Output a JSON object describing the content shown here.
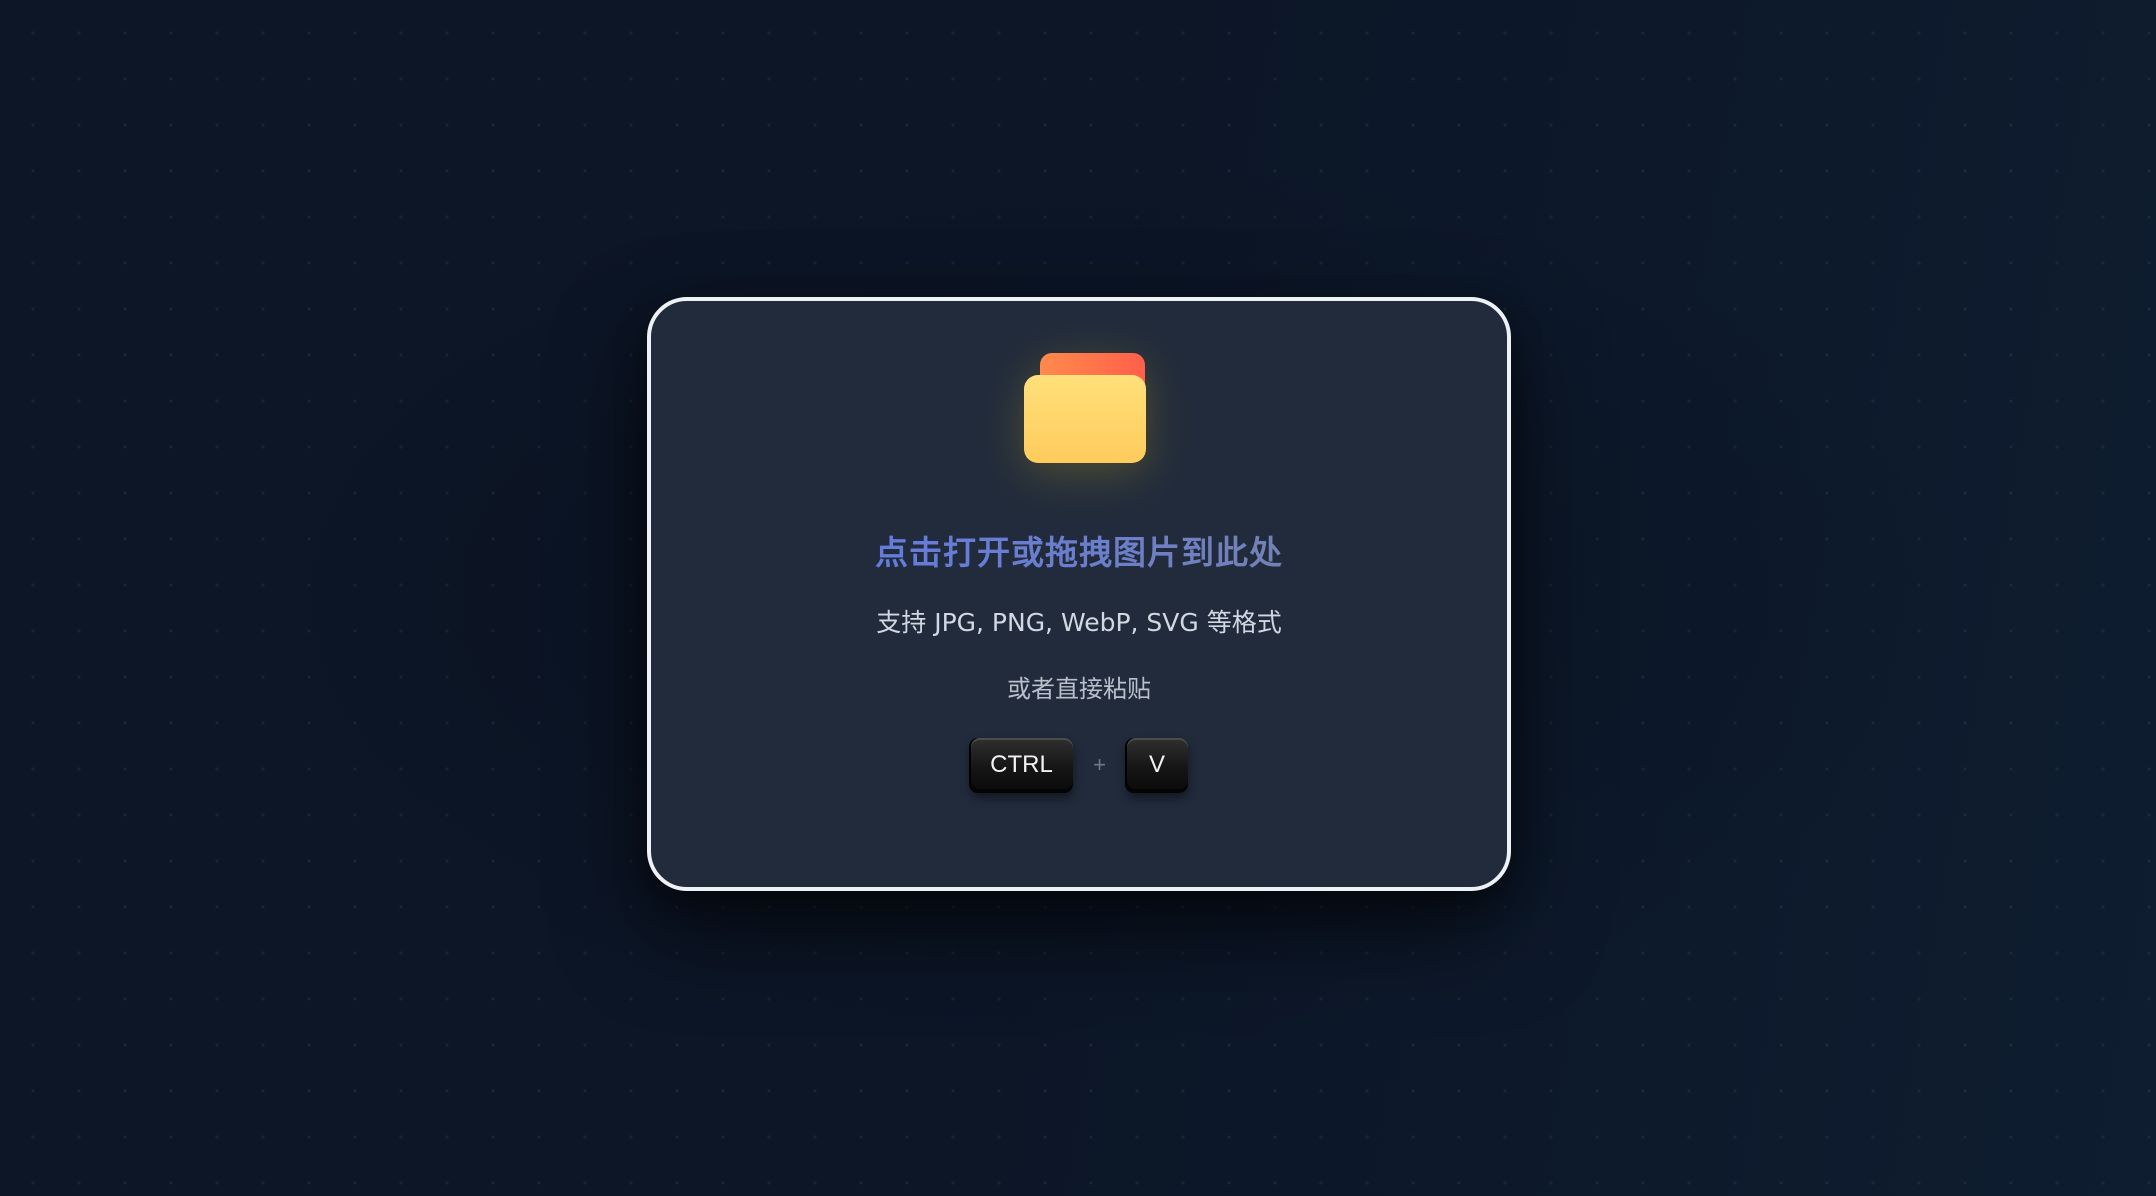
{
  "dropzone": {
    "icon": "folder-icon",
    "title": "点击打开或拖拽图片到此处",
    "formats_hint": "支持 JPG, PNG, WebP, SVG 等格式",
    "paste_hint": "或者直接粘贴",
    "shortcut": {
      "key1": "CTRL",
      "separator": "+",
      "key2": "V"
    }
  },
  "colors": {
    "background": "#0d1626",
    "card": "#212b3b",
    "card_border": "#eef1f5",
    "title_start": "#5b79f0",
    "title_end": "#7c8599",
    "folder_back": "#ff6b4a",
    "folder_front": "#ffd166"
  }
}
